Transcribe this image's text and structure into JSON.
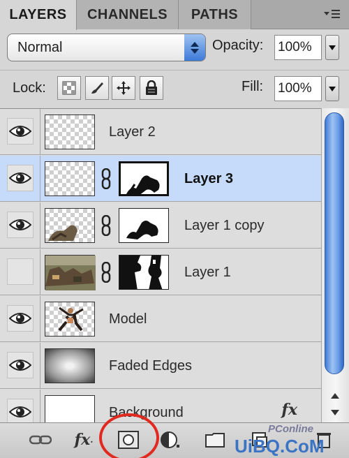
{
  "tabs": [
    {
      "label": "LAYERS",
      "active": true
    },
    {
      "label": "CHANNELS",
      "active": false
    },
    {
      "label": "PATHS",
      "active": false
    }
  ],
  "blend_mode": "Normal",
  "opacity": {
    "label": "Opacity:",
    "value": "100%"
  },
  "lock": {
    "label": "Lock:"
  },
  "fill": {
    "label": "Fill:",
    "value": "100%"
  },
  "layers": [
    {
      "name": "Layer 2",
      "visible": true
    },
    {
      "name": "Layer 3",
      "visible": true
    },
    {
      "name": "Layer 1 copy",
      "visible": true
    },
    {
      "name": "Layer 1",
      "visible": false
    },
    {
      "name": "Model",
      "visible": true
    },
    {
      "name": "Faded Edges",
      "visible": true
    },
    {
      "name": "Background",
      "visible": true
    }
  ],
  "fx_badge": "fx",
  "toolbar": {
    "fx_label": "fx"
  },
  "watermark": {
    "brand": "PConline",
    "site": "UiBQ.CoM"
  },
  "colors": {
    "selection": "#c6dafa",
    "accent_blue": "#3d7ad9",
    "highlight_circle": "#e02a1f"
  }
}
